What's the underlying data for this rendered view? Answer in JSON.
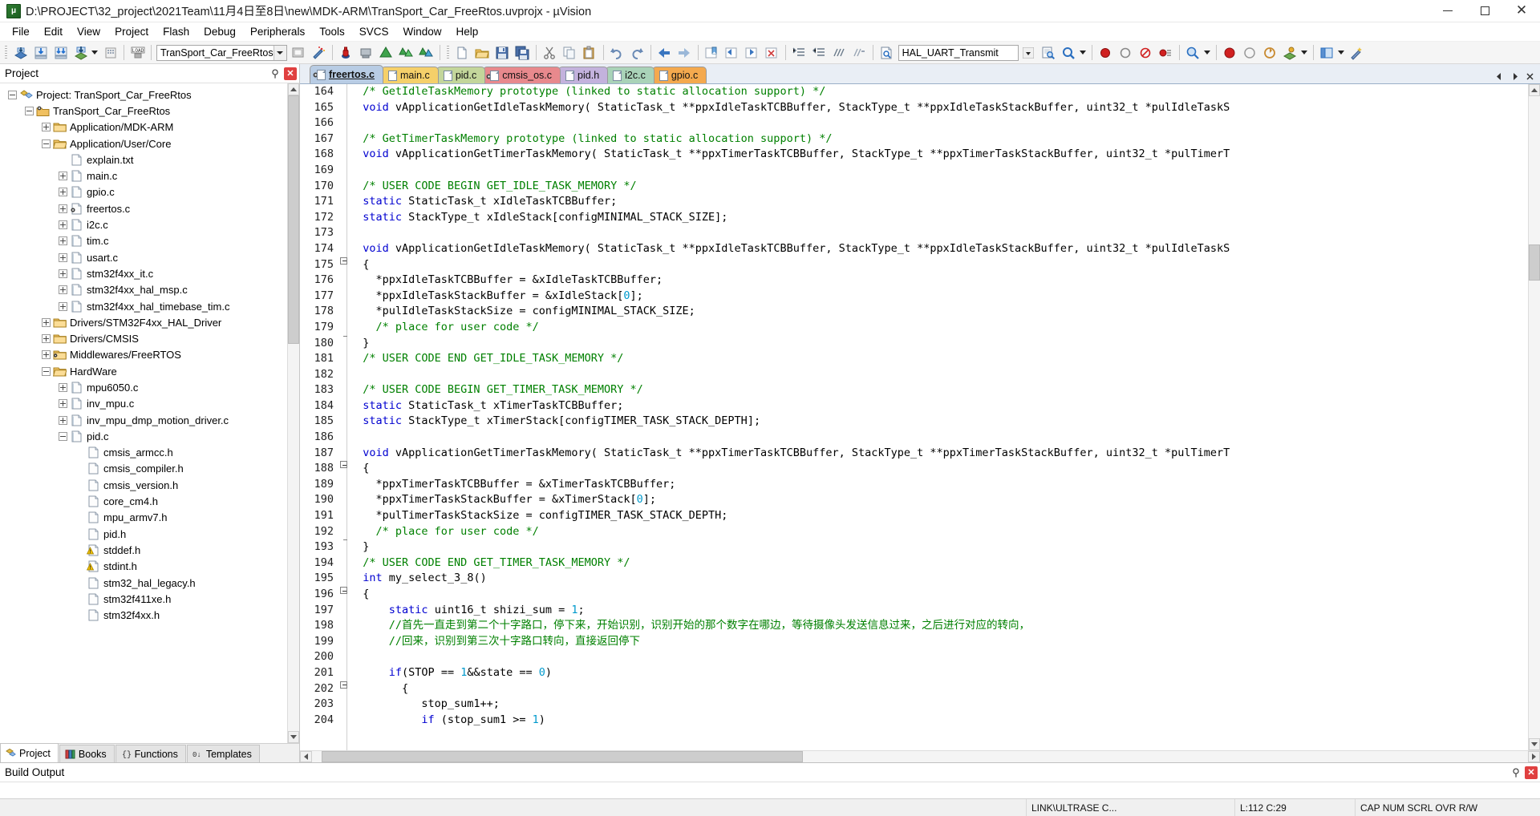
{
  "window": {
    "title": "D:\\PROJECT\\32_project\\2021Team\\11月4日至8日\\new\\MDK-ARM\\TranSport_Car_FreeRtos.uvprojx - µVision",
    "app_icon": "uvision-logo-icon",
    "minimize": "minimize-icon",
    "maximize": "maximize-icon",
    "close": "close-icon"
  },
  "menubar": {
    "items": [
      "File",
      "Edit",
      "View",
      "Project",
      "Flash",
      "Debug",
      "Peripherals",
      "Tools",
      "SVCS",
      "Window",
      "Help"
    ]
  },
  "toolbar": {
    "project_target": "TranSport_Car_FreeRtos",
    "function_box": "HAL_UART_Transmit",
    "icons": [
      "new-file-icon",
      "open-file-icon",
      "save-icon",
      "save-all-icon",
      "cut-icon",
      "copy-icon",
      "paste-icon",
      "undo-icon",
      "redo-icon",
      "navigate-back-icon",
      "navigate-forward-icon",
      "bookmark-toggle-icon",
      "bookmark-prev-icon",
      "bookmark-next-icon",
      "bookmark-clear-icon",
      "indent-icon",
      "outdent-icon",
      "comment-icon",
      "uncomment-icon",
      "function-search-icon",
      "dropdown-arrow-icon",
      "find-in-files-icon",
      "debug-start-icon",
      "insert-breakpoint-icon",
      "kill-breakpoints-icon",
      "enable-breakpoint-icon",
      "zoom-icon",
      "target-options-icon",
      "manage-runtime-icon",
      "build-icon",
      "rebuild-icon",
      "batch-build-icon",
      "download-icon",
      "configure-flash-icon",
      "load-icon",
      "translate-icon",
      "magic-wand-icon"
    ]
  },
  "project_pane": {
    "header": "Project",
    "pin_icon": "pin-icon",
    "close_icon": "close-icon",
    "tree": [
      {
        "depth": 0,
        "toggle": "minus",
        "icon": "project-icon",
        "label": "Project: TranSport_Car_FreeRtos"
      },
      {
        "depth": 1,
        "toggle": "minus",
        "icon": "target-icon",
        "label": "TranSport_Car_FreeRtos"
      },
      {
        "depth": 2,
        "toggle": "plus",
        "icon": "folder-icon",
        "label": "Application/MDK-ARM"
      },
      {
        "depth": 2,
        "toggle": "minus",
        "icon": "folder-open-icon",
        "label": "Application/User/Core"
      },
      {
        "depth": 3,
        "toggle": "none",
        "icon": "text-file-icon",
        "label": "explain.txt"
      },
      {
        "depth": 3,
        "toggle": "plus",
        "icon": "c-file-icon",
        "label": "main.c"
      },
      {
        "depth": 3,
        "toggle": "plus",
        "icon": "c-file-icon",
        "label": "gpio.c"
      },
      {
        "depth": 3,
        "toggle": "plus",
        "icon": "c-file-rtos-icon",
        "label": "freertos.c"
      },
      {
        "depth": 3,
        "toggle": "plus",
        "icon": "c-file-icon",
        "label": "i2c.c"
      },
      {
        "depth": 3,
        "toggle": "plus",
        "icon": "c-file-icon",
        "label": "tim.c"
      },
      {
        "depth": 3,
        "toggle": "plus",
        "icon": "c-file-icon",
        "label": "usart.c"
      },
      {
        "depth": 3,
        "toggle": "plus",
        "icon": "c-file-icon",
        "label": "stm32f4xx_it.c"
      },
      {
        "depth": 3,
        "toggle": "plus",
        "icon": "c-file-icon",
        "label": "stm32f4xx_hal_msp.c"
      },
      {
        "depth": 3,
        "toggle": "plus",
        "icon": "c-file-icon",
        "label": "stm32f4xx_hal_timebase_tim.c"
      },
      {
        "depth": 2,
        "toggle": "plus",
        "icon": "folder-icon",
        "label": "Drivers/STM32F4xx_HAL_Driver"
      },
      {
        "depth": 2,
        "toggle": "plus",
        "icon": "folder-icon",
        "label": "Drivers/CMSIS"
      },
      {
        "depth": 2,
        "toggle": "plus",
        "icon": "folder-rtos-icon",
        "label": "Middlewares/FreeRTOS"
      },
      {
        "depth": 2,
        "toggle": "minus",
        "icon": "folder-open-icon",
        "label": "HardWare"
      },
      {
        "depth": 3,
        "toggle": "plus",
        "icon": "c-file-icon",
        "label": "mpu6050.c"
      },
      {
        "depth": 3,
        "toggle": "plus",
        "icon": "c-file-icon",
        "label": "inv_mpu.c"
      },
      {
        "depth": 3,
        "toggle": "plus",
        "icon": "c-file-icon",
        "label": "inv_mpu_dmp_motion_driver.c"
      },
      {
        "depth": 3,
        "toggle": "minus",
        "icon": "c-file-icon",
        "label": "pid.c"
      },
      {
        "depth": 4,
        "toggle": "none",
        "icon": "h-file-icon",
        "label": "cmsis_armcc.h"
      },
      {
        "depth": 4,
        "toggle": "none",
        "icon": "h-file-icon",
        "label": "cmsis_compiler.h"
      },
      {
        "depth": 4,
        "toggle": "none",
        "icon": "h-file-icon",
        "label": "cmsis_version.h"
      },
      {
        "depth": 4,
        "toggle": "none",
        "icon": "h-file-icon",
        "label": "core_cm4.h"
      },
      {
        "depth": 4,
        "toggle": "none",
        "icon": "h-file-icon",
        "label": "mpu_armv7.h"
      },
      {
        "depth": 4,
        "toggle": "none",
        "icon": "h-file-icon",
        "label": "pid.h"
      },
      {
        "depth": 4,
        "toggle": "none",
        "icon": "h-file-warn-icon",
        "label": "stddef.h"
      },
      {
        "depth": 4,
        "toggle": "none",
        "icon": "h-file-warn-icon",
        "label": "stdint.h"
      },
      {
        "depth": 4,
        "toggle": "none",
        "icon": "h-file-icon",
        "label": "stm32_hal_legacy.h"
      },
      {
        "depth": 4,
        "toggle": "none",
        "icon": "h-file-icon",
        "label": "stm32f411xe.h"
      },
      {
        "depth": 4,
        "toggle": "none",
        "icon": "h-file-icon",
        "label": "stm32f4xx.h"
      }
    ],
    "tabs": [
      {
        "label": "Project",
        "icon": "project-tab-icon",
        "active": true
      },
      {
        "label": "Books",
        "icon": "books-tab-icon",
        "active": false
      },
      {
        "label": "Functions",
        "icon": "functions-tab-icon",
        "active": false
      },
      {
        "label": "Templates",
        "icon": "templates-tab-icon",
        "active": false
      }
    ]
  },
  "editor": {
    "tabs": [
      {
        "label": "freertos.c",
        "color": "#b8cce4",
        "active": true,
        "gear": true
      },
      {
        "label": "main.c",
        "color": "#f5d06a",
        "active": false,
        "gear": false
      },
      {
        "label": "pid.c",
        "color": "#c3d69b",
        "active": false,
        "gear": false
      },
      {
        "label": "cmsis_os.c",
        "color": "#e8898d",
        "active": false,
        "gear": true
      },
      {
        "label": "pid.h",
        "color": "#c3b2dd",
        "active": false,
        "gear": false
      },
      {
        "label": "i2c.c",
        "color": "#a9d3b8",
        "active": false,
        "gear": false
      },
      {
        "label": "gpio.c",
        "color": "#f4a94e",
        "active": false,
        "gear": false
      }
    ],
    "tab_nav": [
      "tab-scroll-left-icon",
      "tab-scroll-right-icon",
      "tab-close-icon"
    ],
    "first_line_number": 164,
    "lines": [
      {
        "n": 164,
        "fold": "",
        "tokens": [
          {
            "t": "  ",
            "c": ""
          },
          {
            "t": "/* GetIdleTaskMemory prototype (linked to static allocation support) */",
            "c": "cm"
          }
        ]
      },
      {
        "n": 165,
        "fold": "",
        "tokens": [
          {
            "t": "  ",
            "c": ""
          },
          {
            "t": "void",
            "c": "kw"
          },
          {
            "t": " vApplicationGetIdleTaskMemory( StaticTask_t **ppxIdleTaskTCBBuffer, StackType_t **ppxIdleTaskStackBuffer, uint32_t *pulIdleTaskS",
            "c": ""
          }
        ]
      },
      {
        "n": 166,
        "fold": "",
        "tokens": []
      },
      {
        "n": 167,
        "fold": "",
        "tokens": [
          {
            "t": "  ",
            "c": ""
          },
          {
            "t": "/* GetTimerTaskMemory prototype (linked to static allocation support) */",
            "c": "cm"
          }
        ]
      },
      {
        "n": 168,
        "fold": "",
        "tokens": [
          {
            "t": "  ",
            "c": ""
          },
          {
            "t": "void",
            "c": "kw"
          },
          {
            "t": " vApplicationGetTimerTaskMemory( StaticTask_t **ppxTimerTaskTCBBuffer, StackType_t **ppxTimerTaskStackBuffer, uint32_t *pulTimerT",
            "c": ""
          }
        ]
      },
      {
        "n": 169,
        "fold": "",
        "tokens": []
      },
      {
        "n": 170,
        "fold": "",
        "tokens": [
          {
            "t": "  ",
            "c": ""
          },
          {
            "t": "/* USER CODE BEGIN GET_IDLE_TASK_MEMORY */",
            "c": "cm"
          }
        ]
      },
      {
        "n": 171,
        "fold": "",
        "tokens": [
          {
            "t": "  ",
            "c": ""
          },
          {
            "t": "static",
            "c": "kw"
          },
          {
            "t": " StaticTask_t xIdleTaskTCBBuffer;",
            "c": ""
          }
        ]
      },
      {
        "n": 172,
        "fold": "",
        "tokens": [
          {
            "t": "  ",
            "c": ""
          },
          {
            "t": "static",
            "c": "kw"
          },
          {
            "t": " StackType_t xIdleStack[configMINIMAL_STACK_SIZE];",
            "c": ""
          }
        ]
      },
      {
        "n": 173,
        "fold": "",
        "tokens": []
      },
      {
        "n": 174,
        "fold": "",
        "tokens": [
          {
            "t": "  ",
            "c": ""
          },
          {
            "t": "void",
            "c": "kw"
          },
          {
            "t": " vApplicationGetIdleTaskMemory( StaticTask_t **ppxIdleTaskTCBBuffer, StackType_t **ppxIdleTaskStackBuffer, uint32_t *pulIdleTaskS",
            "c": ""
          }
        ]
      },
      {
        "n": 175,
        "fold": "start",
        "tokens": [
          {
            "t": "  {",
            "c": ""
          }
        ]
      },
      {
        "n": 176,
        "fold": "bar",
        "tokens": [
          {
            "t": "    *ppxIdleTaskTCBBuffer = &xIdleTaskTCBBuffer;",
            "c": ""
          }
        ]
      },
      {
        "n": 177,
        "fold": "bar",
        "tokens": [
          {
            "t": "    *ppxIdleTaskStackBuffer = &xIdleStack[",
            "c": ""
          },
          {
            "t": "0",
            "c": "num"
          },
          {
            "t": "];",
            "c": ""
          }
        ]
      },
      {
        "n": 178,
        "fold": "bar",
        "tokens": [
          {
            "t": "    *pulIdleTaskStackSize = configMINIMAL_STACK_SIZE;",
            "c": ""
          }
        ]
      },
      {
        "n": 179,
        "fold": "bar",
        "tokens": [
          {
            "t": "    ",
            "c": ""
          },
          {
            "t": "/* place for user code */",
            "c": "cm"
          }
        ]
      },
      {
        "n": 180,
        "fold": "end",
        "tokens": [
          {
            "t": "  }",
            "c": ""
          }
        ]
      },
      {
        "n": 181,
        "fold": "",
        "tokens": [
          {
            "t": "  ",
            "c": ""
          },
          {
            "t": "/* USER CODE END GET_IDLE_TASK_MEMORY */",
            "c": "cm"
          }
        ]
      },
      {
        "n": 182,
        "fold": "",
        "tokens": []
      },
      {
        "n": 183,
        "fold": "",
        "tokens": [
          {
            "t": "  ",
            "c": ""
          },
          {
            "t": "/* USER CODE BEGIN GET_TIMER_TASK_MEMORY */",
            "c": "cm"
          }
        ]
      },
      {
        "n": 184,
        "fold": "",
        "tokens": [
          {
            "t": "  ",
            "c": ""
          },
          {
            "t": "static",
            "c": "kw"
          },
          {
            "t": " StaticTask_t xTimerTaskTCBBuffer;",
            "c": ""
          }
        ]
      },
      {
        "n": 185,
        "fold": "",
        "tokens": [
          {
            "t": "  ",
            "c": ""
          },
          {
            "t": "static",
            "c": "kw"
          },
          {
            "t": " StackType_t xTimerStack[configTIMER_TASK_STACK_DEPTH];",
            "c": ""
          }
        ]
      },
      {
        "n": 186,
        "fold": "",
        "tokens": []
      },
      {
        "n": 187,
        "fold": "",
        "tokens": [
          {
            "t": "  ",
            "c": ""
          },
          {
            "t": "void",
            "c": "kw"
          },
          {
            "t": " vApplicationGetTimerTaskMemory( StaticTask_t **ppxTimerTaskTCBBuffer, StackType_t **ppxTimerTaskStackBuffer, uint32_t *pulTimerT",
            "c": ""
          }
        ]
      },
      {
        "n": 188,
        "fold": "start",
        "tokens": [
          {
            "t": "  {",
            "c": ""
          }
        ]
      },
      {
        "n": 189,
        "fold": "bar",
        "tokens": [
          {
            "t": "    *ppxTimerTaskTCBBuffer = &xTimerTaskTCBBuffer;",
            "c": ""
          }
        ]
      },
      {
        "n": 190,
        "fold": "bar",
        "tokens": [
          {
            "t": "    *ppxTimerTaskStackBuffer = &xTimerStack[",
            "c": ""
          },
          {
            "t": "0",
            "c": "num"
          },
          {
            "t": "];",
            "c": ""
          }
        ]
      },
      {
        "n": 191,
        "fold": "bar",
        "tokens": [
          {
            "t": "    *pulTimerTaskStackSize = configTIMER_TASK_STACK_DEPTH;",
            "c": ""
          }
        ]
      },
      {
        "n": 192,
        "fold": "bar",
        "tokens": [
          {
            "t": "    ",
            "c": ""
          },
          {
            "t": "/* place for user code */",
            "c": "cm"
          }
        ]
      },
      {
        "n": 193,
        "fold": "end",
        "tokens": [
          {
            "t": "  }",
            "c": ""
          }
        ]
      },
      {
        "n": 194,
        "fold": "",
        "tokens": [
          {
            "t": "  ",
            "c": ""
          },
          {
            "t": "/* USER CODE END GET_TIMER_TASK_MEMORY */",
            "c": "cm"
          }
        ]
      },
      {
        "n": 195,
        "fold": "",
        "tokens": [
          {
            "t": "  ",
            "c": ""
          },
          {
            "t": "int",
            "c": "kw"
          },
          {
            "t": " my_select_3_8()",
            "c": ""
          }
        ]
      },
      {
        "n": 196,
        "fold": "start",
        "tokens": [
          {
            "t": "  {",
            "c": ""
          }
        ]
      },
      {
        "n": 197,
        "fold": "bar",
        "tokens": [
          {
            "t": "      ",
            "c": ""
          },
          {
            "t": "static",
            "c": "kw"
          },
          {
            "t": " uint16_t shizi_sum = ",
            "c": ""
          },
          {
            "t": "1",
            "c": "num"
          },
          {
            "t": ";",
            "c": ""
          }
        ]
      },
      {
        "n": 198,
        "fold": "bar",
        "tokens": [
          {
            "t": "      ",
            "c": ""
          },
          {
            "t": "//首先一直走到第二个十字路口，停下来，开始识别，识别开始的那个数字在哪边，等待摄像头发送信息过来，之后进行对应的转向，",
            "c": "cm"
          }
        ]
      },
      {
        "n": 199,
        "fold": "bar",
        "tokens": [
          {
            "t": "      ",
            "c": ""
          },
          {
            "t": "//回来，识别到第三次十字路口转向，直接返回停下",
            "c": "cm"
          }
        ]
      },
      {
        "n": 200,
        "fold": "bar",
        "tokens": []
      },
      {
        "n": 201,
        "fold": "bar",
        "tokens": [
          {
            "t": "      ",
            "c": ""
          },
          {
            "t": "if",
            "c": "kw"
          },
          {
            "t": "(STOP == ",
            "c": ""
          },
          {
            "t": "1",
            "c": "num"
          },
          {
            "t": "&&state == ",
            "c": ""
          },
          {
            "t": "0",
            "c": "num"
          },
          {
            "t": ")",
            "c": ""
          }
        ]
      },
      {
        "n": 202,
        "fold": "start2",
        "tokens": [
          {
            "t": "        {",
            "c": ""
          }
        ]
      },
      {
        "n": 203,
        "fold": "bar",
        "tokens": [
          {
            "t": "           stop_sum1++;",
            "c": ""
          }
        ]
      },
      {
        "n": 204,
        "fold": "bar",
        "tokens": [
          {
            "t": "           ",
            "c": ""
          },
          {
            "t": "if",
            "c": "kw"
          },
          {
            "t": " (stop_sum1 >= ",
            "c": ""
          },
          {
            "t": "1",
            "c": "num"
          },
          {
            "t": ")",
            "c": ""
          }
        ]
      }
    ]
  },
  "build_output": {
    "title": "Build Output",
    "pin_icon": "pin-icon",
    "close_icon": "close-icon",
    "lines": []
  },
  "statusbar": {
    "left": "",
    "debugger": "LINK\\ULTRASE C...",
    "position": "L:112 C:29",
    "modes": "CAP NUM SCRL OVR R/W"
  },
  "colors": {
    "keyword": "#0000d0",
    "comment": "#008000",
    "number": "#0099cc",
    "accent": "#0078d7",
    "titlebar_bg": "#ffffff"
  }
}
